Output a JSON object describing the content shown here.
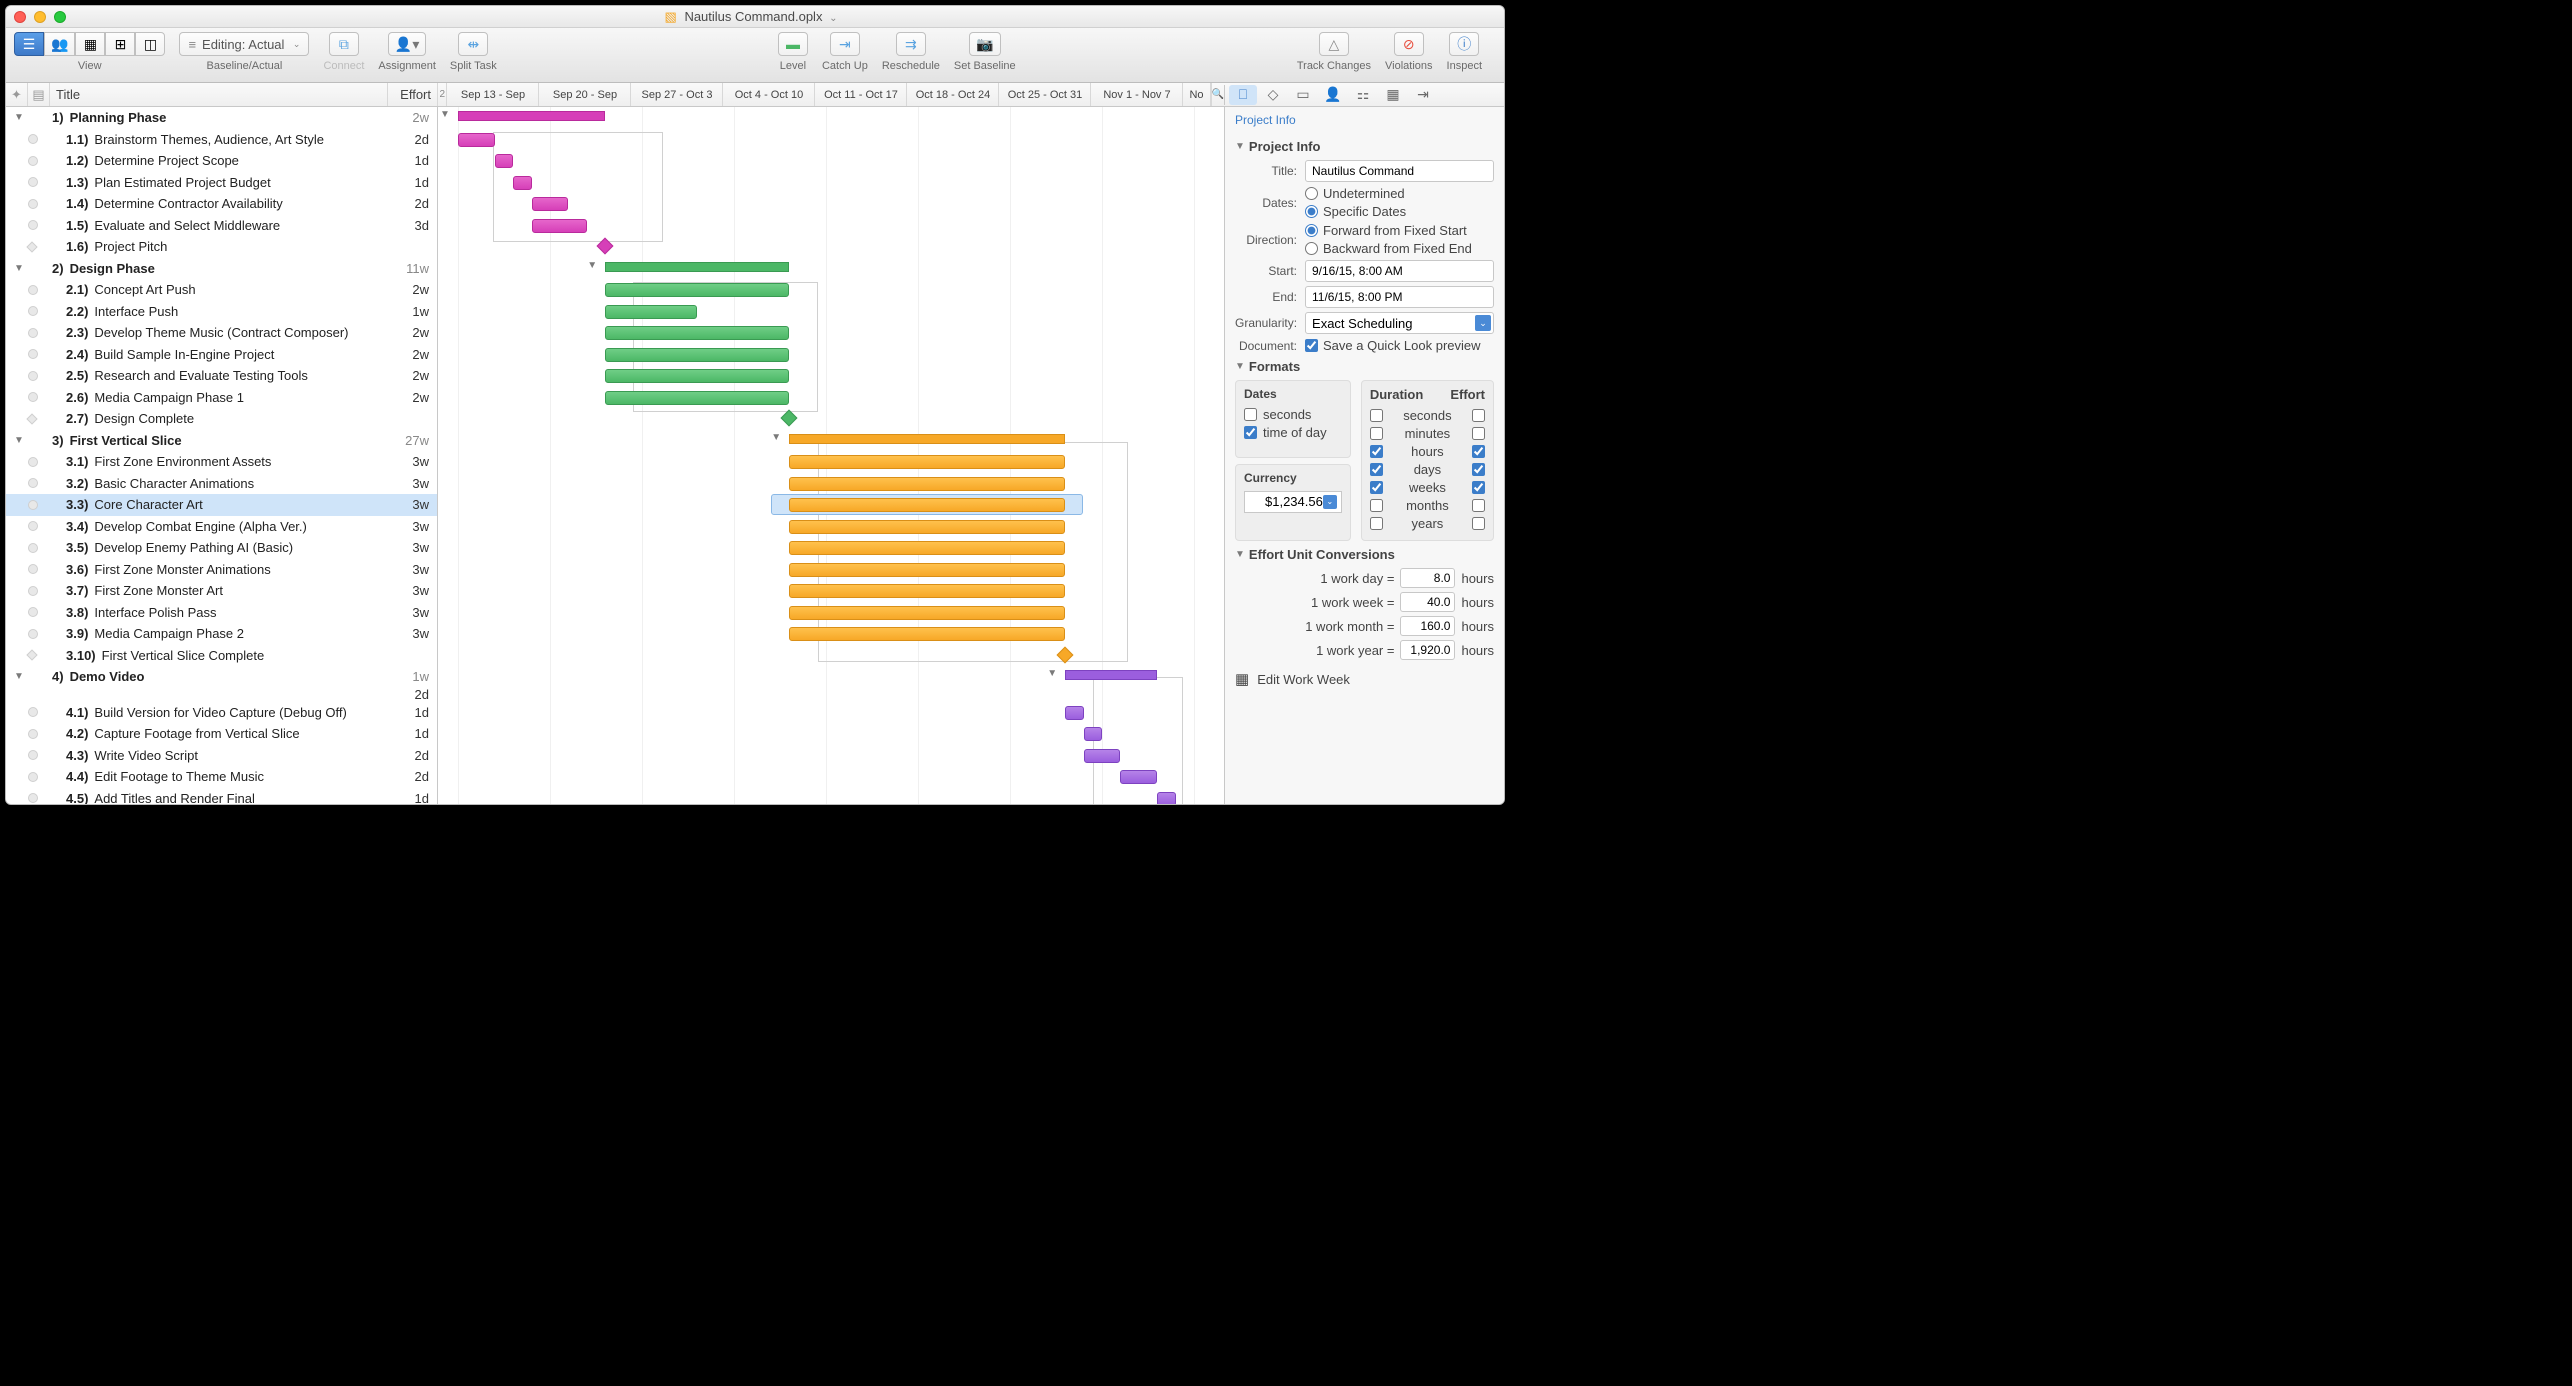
{
  "title": "Nautilus Command.oplx",
  "toolbar": {
    "view": "View",
    "baseline_actual": "Baseline/Actual",
    "baseline_sel": "Editing: Actual",
    "connect": "Connect",
    "assignment": "Assignment",
    "split_task": "Split Task",
    "level": "Level",
    "catch_up": "Catch Up",
    "reschedule": "Reschedule",
    "set_baseline": "Set Baseline",
    "track_changes": "Track Changes",
    "violations": "Violations",
    "inspect": "Inspect"
  },
  "columns": {
    "title": "Title",
    "effort": "Effort"
  },
  "timeline": [
    "Sep 13 - Sep",
    "Sep 20 - Sep",
    "Sep 27 - Oct 3",
    "Oct 4 - Oct 10",
    "Oct 11 - Oct 17",
    "Oct 18 - Oct 24",
    "Oct 25 - Oct 31",
    "Nov 1 - Nov 7",
    "No"
  ],
  "tasks": [
    {
      "n": "1)",
      "t": "Planning Phase",
      "e": "2w",
      "head": true
    },
    {
      "n": "1.1)",
      "t": "Brainstorm Themes, Audience, Art Style",
      "e": "2d"
    },
    {
      "n": "1.2)",
      "t": "Determine Project Scope",
      "e": "1d"
    },
    {
      "n": "1.3)",
      "t": "Plan Estimated Project Budget",
      "e": "1d"
    },
    {
      "n": "1.4)",
      "t": "Determine Contractor Availability",
      "e": "2d"
    },
    {
      "n": "1.5)",
      "t": "Evaluate and Select Middleware",
      "e": "3d"
    },
    {
      "n": "1.6)",
      "t": "Project Pitch",
      "e": "",
      "ms": true
    },
    {
      "n": "2)",
      "t": "Design Phase",
      "e": "11w",
      "head": true
    },
    {
      "n": "2.1)",
      "t": "Concept Art Push",
      "e": "2w"
    },
    {
      "n": "2.2)",
      "t": "Interface Push",
      "e": "1w"
    },
    {
      "n": "2.3)",
      "t": "Develop Theme Music (Contract Composer)",
      "e": "2w"
    },
    {
      "n": "2.4)",
      "t": "Build Sample In-Engine Project",
      "e": "2w"
    },
    {
      "n": "2.5)",
      "t": "Research and Evaluate Testing Tools",
      "e": "2w"
    },
    {
      "n": "2.6)",
      "t": "Media Campaign Phase 1",
      "e": "2w"
    },
    {
      "n": "2.7)",
      "t": "Design Complete",
      "e": "",
      "ms": true
    },
    {
      "n": "3)",
      "t": "First Vertical Slice",
      "e": "27w",
      "head": true
    },
    {
      "n": "3.1)",
      "t": "First Zone Environment Assets",
      "e": "3w"
    },
    {
      "n": "3.2)",
      "t": "Basic Character Animations",
      "e": "3w"
    },
    {
      "n": "3.3)",
      "t": "Core Character Art",
      "e": "3w",
      "sel": true
    },
    {
      "n": "3.4)",
      "t": "Develop Combat Engine (Alpha Ver.)",
      "e": "3w"
    },
    {
      "n": "3.5)",
      "t": "Develop Enemy Pathing AI (Basic)",
      "e": "3w"
    },
    {
      "n": "3.6)",
      "t": "First Zone Monster Animations",
      "e": "3w"
    },
    {
      "n": "3.7)",
      "t": "First Zone Monster Art",
      "e": "3w"
    },
    {
      "n": "3.8)",
      "t": "Interface Polish Pass",
      "e": "3w"
    },
    {
      "n": "3.9)",
      "t": "Media Campaign Phase 2",
      "e": "3w"
    },
    {
      "n": "3.10)",
      "t": "First Vertical Slice Complete",
      "e": "",
      "ms": true
    },
    {
      "n": "4)",
      "t": "Demo Video",
      "e": "1w\n2d",
      "head": true
    },
    {
      "n": "4.1)",
      "t": "Build Version for Video Capture (Debug Off)",
      "e": "1d"
    },
    {
      "n": "4.2)",
      "t": "Capture Footage from Vertical Slice",
      "e": "1d"
    },
    {
      "n": "4.3)",
      "t": "Write Video Script",
      "e": "2d"
    },
    {
      "n": "4.4)",
      "t": "Edit Footage to Theme Music",
      "e": "2d"
    },
    {
      "n": "4.5)",
      "t": "Add Titles and Render Final",
      "e": "1d"
    }
  ],
  "inspector": {
    "panel_label": "Project Info",
    "section_project": "Project Info",
    "title_lbl": "Title:",
    "title_val": "Nautilus Command",
    "dates_lbl": "Dates:",
    "dates_opt1": "Undetermined",
    "dates_opt2": "Specific Dates",
    "direction_lbl": "Direction:",
    "dir_opt1": "Forward from Fixed Start",
    "dir_opt2": "Backward from Fixed End",
    "start_lbl": "Start:",
    "start_val": "9/16/15, 8:00 AM",
    "end_lbl": "End:",
    "end_val": "11/6/15, 8:00 PM",
    "gran_lbl": "Granularity:",
    "gran_val": "Exact Scheduling",
    "doc_lbl": "Document:",
    "doc_chk": "Save a Quick Look preview",
    "section_formats": "Formats",
    "fmt_dates": "Dates",
    "fmt_seconds": "seconds",
    "fmt_tod": "time of day",
    "fmt_currency": "Currency",
    "currency_val": "$1,234.56",
    "fmt_duration": "Duration",
    "fmt_effort": "Effort",
    "u_seconds": "seconds",
    "u_minutes": "minutes",
    "u_hours": "hours",
    "u_days": "days",
    "u_weeks": "weeks",
    "u_months": "months",
    "u_years": "years",
    "section_conv": "Effort Unit Conversions",
    "c_day": "1 work day =",
    "c_day_v": "8.0",
    "c_day_u": "hours",
    "c_week": "1 work week =",
    "c_week_v": "40.0",
    "c_week_u": "hours",
    "c_month": "1 work month =",
    "c_month_v": "160.0",
    "c_month_u": "hours",
    "c_year": "1 work year =",
    "c_year_v": "1,920.0",
    "c_year_u": "hours",
    "edit_ww": "Edit Work Week"
  }
}
